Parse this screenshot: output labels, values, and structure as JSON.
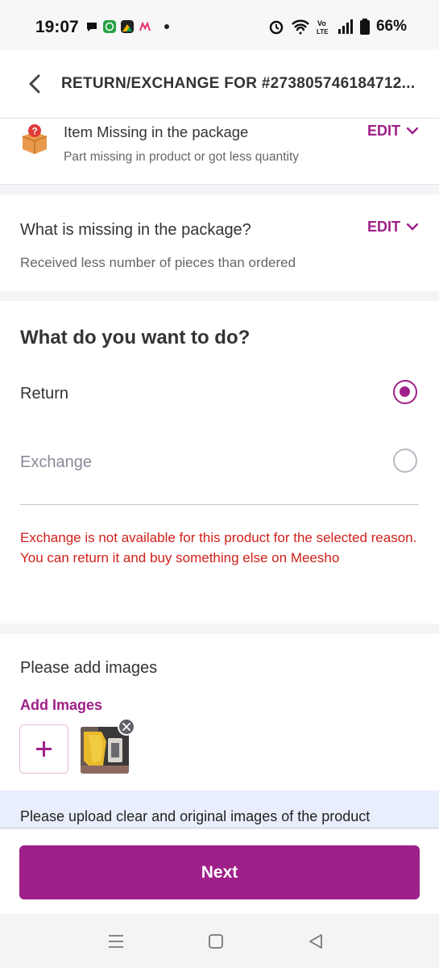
{
  "status_bar": {
    "time": "19:07",
    "battery": "66%",
    "left_icons": [
      "chat-bubble-icon",
      "whatsapp-icon",
      "photos-icon",
      "myntra-icon",
      "dot-icon"
    ],
    "right_icons": [
      "alarm-icon",
      "wifi-icon",
      "volte-icon",
      "signal-icon",
      "battery-icon"
    ],
    "volte_label": "Vo\nLTE"
  },
  "header": {
    "title": "RETURN/EXCHANGE FOR #273805746184712...",
    "back_icon": "chevron-left-icon"
  },
  "reason": {
    "title": "Item Missing in the package",
    "subtitle": "Part missing in product or got less quantity",
    "edit_label": "EDIT",
    "icon": "box-question-icon"
  },
  "missing": {
    "title": "What is missing in the package?",
    "subtitle": "Received less number of pieces than ordered",
    "edit_label": "EDIT"
  },
  "action": {
    "title": "What do you want to do?",
    "options": [
      {
        "label": "Return",
        "selected": true,
        "enabled": true
      },
      {
        "label": "Exchange",
        "selected": false,
        "enabled": false
      }
    ],
    "warning": "Exchange is not available for this product for the selected reason. You can return it and buy something else on Meesho"
  },
  "images": {
    "title": "Please add images",
    "add_link": "Add Images",
    "uploaded_count": 1
  },
  "info_banner": {
    "text": "Please upload clear and original images of the product"
  },
  "footer": {
    "next_label": "Next"
  },
  "colors": {
    "accent": "#9f2089",
    "error": "#d0201a",
    "info_bg": "#e9eefc"
  },
  "navbar": {
    "icons": [
      "recent-apps-icon",
      "home-icon",
      "back-icon"
    ]
  }
}
